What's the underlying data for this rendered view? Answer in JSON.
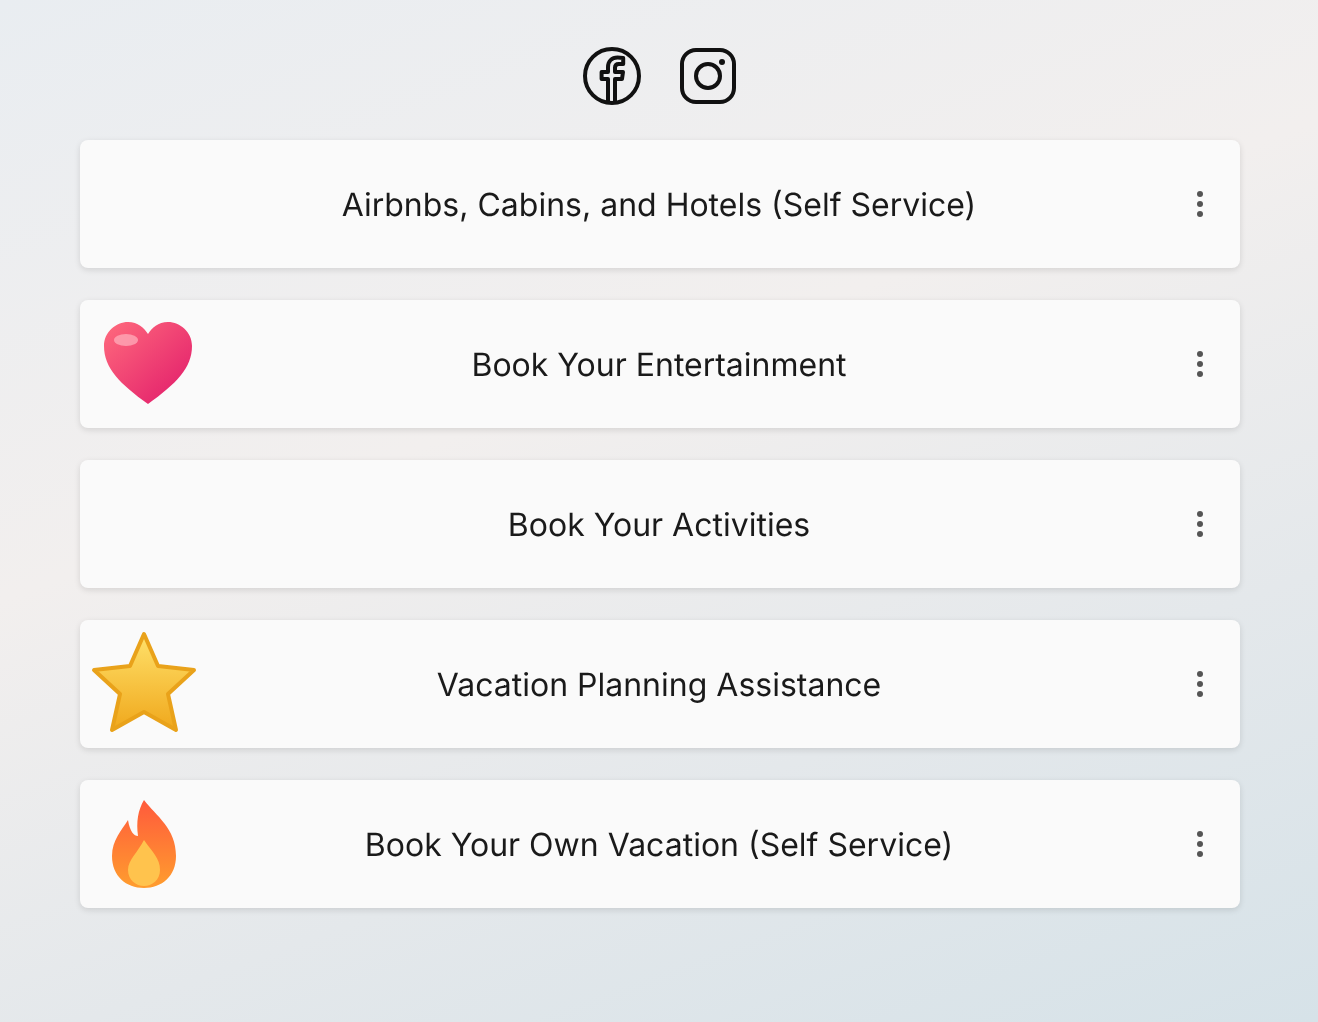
{
  "links": [
    {
      "label": "Airbnbs, Cabins, and Hotels (Self Service)",
      "kind": "plain"
    },
    {
      "label": "Book Your Entertainment",
      "kind": "heart"
    },
    {
      "label": "Book Your Activities",
      "kind": "plain"
    },
    {
      "label": "Vacation Planning Assistance",
      "kind": "star"
    },
    {
      "label": "Book Your Own Vacation (Self Service)",
      "kind": "fire"
    }
  ]
}
